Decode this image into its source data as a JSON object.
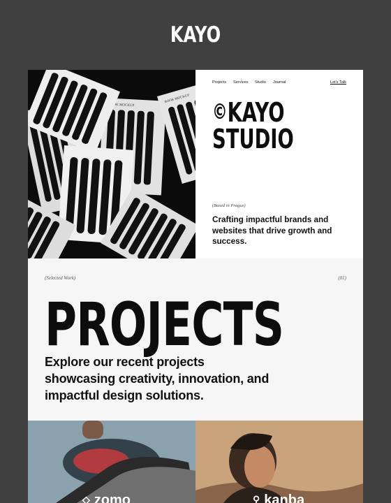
{
  "brand": {
    "title": "KAYO"
  },
  "nav": {
    "items": [
      "Projects",
      "Services",
      "Studio",
      "Journal"
    ],
    "cta": "Let's Talk"
  },
  "hero": {
    "copyright_mark": "©",
    "line1": "KAYO",
    "line2": "STUDIO",
    "based": "(Based in Prague)",
    "tagline": "Crafting impactful brands and websites that drive growth and success.",
    "image_text": {
      "book1": "BOOK MOCKUP",
      "book2": "BOOK MOCKUP"
    }
  },
  "work": {
    "label": "(Selected Work)",
    "index": "(01)",
    "heading": "PROJECTS",
    "description": "Explore our recent projects showcasing creativity, innovation, and impactful design solutions."
  },
  "thumbs": [
    {
      "icon": "diamond-icon",
      "label": "zomo"
    },
    {
      "icon": "pin-icon",
      "label": "kanba"
    }
  ]
}
